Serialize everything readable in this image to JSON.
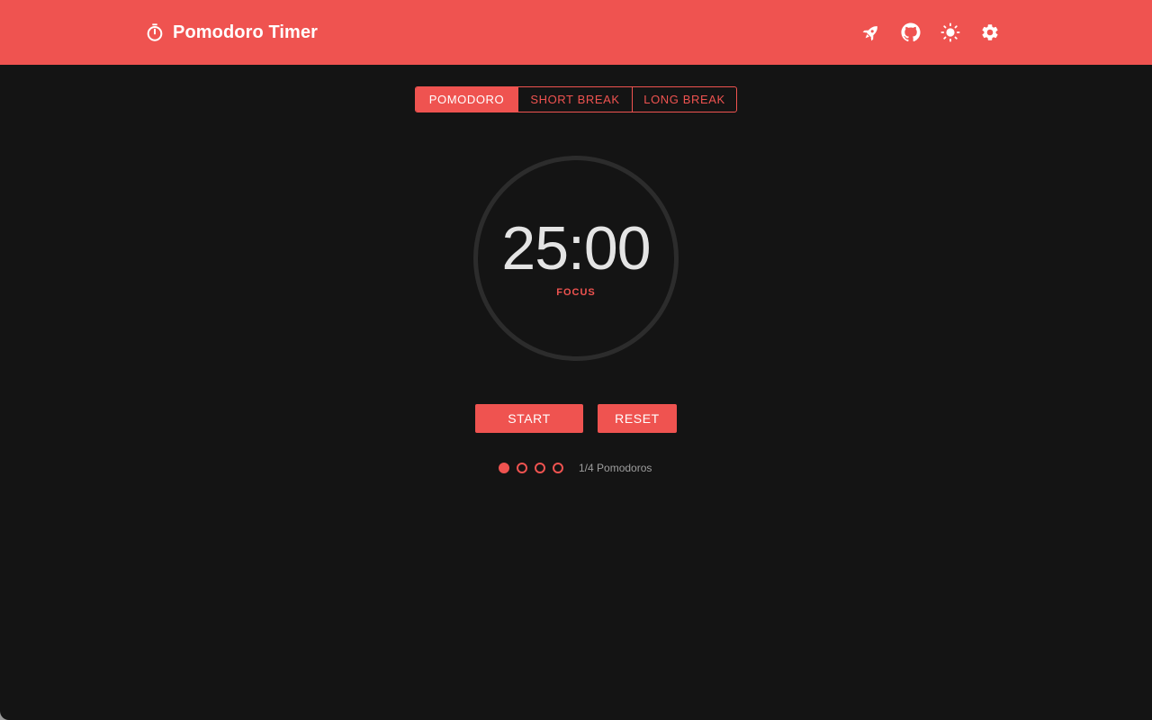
{
  "app": {
    "title": "Pomodoro Timer",
    "brand_icon": "stopwatch-icon"
  },
  "header_actions": [
    {
      "icon": "rocket-icon"
    },
    {
      "icon": "github-icon"
    },
    {
      "icon": "sun-icon"
    },
    {
      "icon": "gear-icon"
    }
  ],
  "modes": [
    {
      "label": "POMODORO",
      "active": true
    },
    {
      "label": "SHORT BREAK",
      "active": false
    },
    {
      "label": "LONG BREAK",
      "active": false
    }
  ],
  "timer": {
    "time": "25:00",
    "label": "FOCUS",
    "progress": 0
  },
  "controls": {
    "start_label": "START",
    "reset_label": "RESET"
  },
  "session": {
    "completed": 1,
    "total": 4,
    "text": "1/4 Pomodoros"
  },
  "colors": {
    "accent": "#ef5350",
    "background": "#141414",
    "ring_track": "#2c2c2c",
    "timer_text": "#e4e4e4",
    "muted_text": "#9e9e9e"
  }
}
